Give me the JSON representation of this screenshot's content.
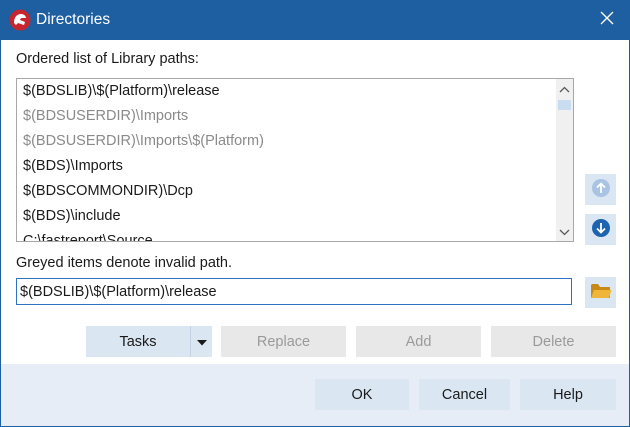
{
  "window": {
    "title": "Directories",
    "app_icon": "delphi-helmet-icon",
    "close_icon": "close-icon"
  },
  "list_label": "Ordered list of Library paths:",
  "paths": [
    {
      "text": "$(BDSLIB)\\$(Platform)\\release",
      "valid": true
    },
    {
      "text": "$(BDSUSERDIR)\\Imports",
      "valid": false
    },
    {
      "text": "$(BDSUSERDIR)\\Imports\\$(Platform)",
      "valid": false
    },
    {
      "text": "$(BDS)\\Imports",
      "valid": true
    },
    {
      "text": "$(BDSCOMMONDIR)\\Dcp",
      "valid": true
    },
    {
      "text": "$(BDS)\\include",
      "valid": true
    },
    {
      "text": "C:\\fastreport\\Source",
      "valid": true
    }
  ],
  "hint": "Greyed items denote invalid path.",
  "path_input": {
    "value": "$(BDSLIB)\\$(Platform)\\release"
  },
  "buttons": {
    "tasks": "Tasks",
    "replace": "Replace",
    "add": "Add",
    "delete": "Delete",
    "ok": "OK",
    "cancel": "Cancel",
    "help": "Help"
  },
  "colors": {
    "titlebar": "#1d5fa0",
    "accent_button": "#dbe6f3",
    "arrow_icon": "#1e63b0",
    "invalid_text": "#8a8a8a"
  }
}
